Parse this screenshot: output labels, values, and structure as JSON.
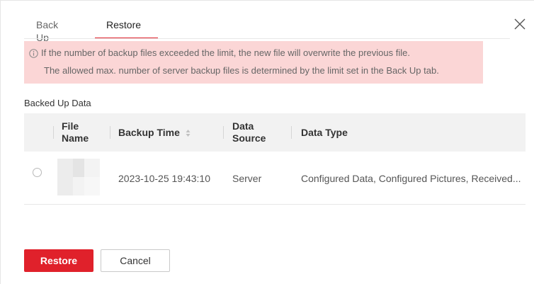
{
  "tabs": [
    {
      "label": "Back Up",
      "active": false
    },
    {
      "label": "Restore",
      "active": true
    }
  ],
  "notice": {
    "line1": "If the number of backup files exceeded the limit, the new file will overwrite the previous file.",
    "line2": "The allowed max. number of server backup files is determined by the limit set in the Back Up tab."
  },
  "section_title": "Backed Up Data",
  "table": {
    "headers": {
      "file_name_1": "File",
      "file_name_2": "Name",
      "backup_time": "Backup Time",
      "data_source_1": "Data",
      "data_source_2": "Source",
      "data_type": "Data Type"
    },
    "rows": [
      {
        "selected": false,
        "backup_time": "2023-10-25 19:43:10",
        "data_source": "Server",
        "data_type": "Configured Data, Configured Pictures, Received..."
      }
    ]
  },
  "buttons": {
    "restore": "Restore",
    "cancel": "Cancel"
  },
  "colors": {
    "accent": "#e0212b",
    "notice_bg": "#fbd6d6",
    "header_bg": "#f2f2f2"
  },
  "icons": {
    "close": "close-icon",
    "info": "info-icon",
    "sort": "sort-icon"
  }
}
